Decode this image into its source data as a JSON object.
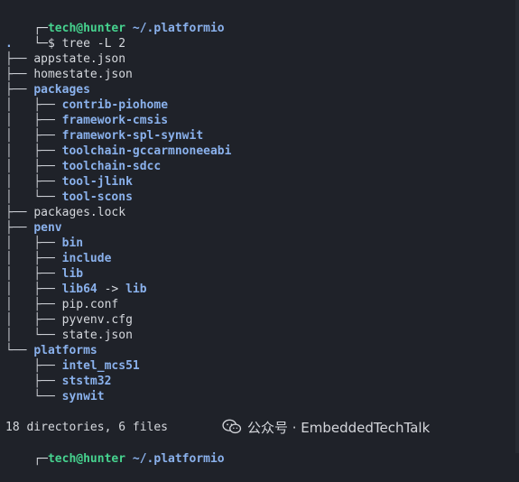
{
  "prompt": {
    "user_host": "tech@hunter",
    "path": "~/.platformio",
    "prefix_top": "┌─",
    "prefix_bottom": "└─",
    "symbol": "$",
    "command": "tree -L 2"
  },
  "tree": {
    "root": ".",
    "entries": [
      {
        "prefix": "├── ",
        "name": "appstate.json",
        "kind": "file"
      },
      {
        "prefix": "├── ",
        "name": "homestate.json",
        "kind": "file"
      },
      {
        "prefix": "├── ",
        "name": "packages",
        "kind": "dir"
      },
      {
        "prefix": "│   ├── ",
        "name": "contrib-piohome",
        "kind": "dir"
      },
      {
        "prefix": "│   ├── ",
        "name": "framework-cmsis",
        "kind": "dir"
      },
      {
        "prefix": "│   ├── ",
        "name": "framework-spl-synwit",
        "kind": "dir"
      },
      {
        "prefix": "│   ├── ",
        "name": "toolchain-gccarmnoneeabi",
        "kind": "dir"
      },
      {
        "prefix": "│   ├── ",
        "name": "toolchain-sdcc",
        "kind": "dir"
      },
      {
        "prefix": "│   ├── ",
        "name": "tool-jlink",
        "kind": "dir"
      },
      {
        "prefix": "│   └── ",
        "name": "tool-scons",
        "kind": "dir"
      },
      {
        "prefix": "├── ",
        "name": "packages.lock",
        "kind": "file"
      },
      {
        "prefix": "├── ",
        "name": "penv",
        "kind": "dir"
      },
      {
        "prefix": "│   ├── ",
        "name": "bin",
        "kind": "dir"
      },
      {
        "prefix": "│   ├── ",
        "name": "include",
        "kind": "dir"
      },
      {
        "prefix": "│   ├── ",
        "name": "lib",
        "kind": "dir"
      },
      {
        "prefix": "│   ├── ",
        "name": "lib64",
        "kind": "link",
        "target": "lib"
      },
      {
        "prefix": "│   ├── ",
        "name": "pip.conf",
        "kind": "file"
      },
      {
        "prefix": "│   ├── ",
        "name": "pyvenv.cfg",
        "kind": "file"
      },
      {
        "prefix": "│   └── ",
        "name": "state.json",
        "kind": "file"
      },
      {
        "prefix": "└── ",
        "name": "platforms",
        "kind": "dir"
      },
      {
        "prefix": "    ├── ",
        "name": "intel_mcs51",
        "kind": "dir"
      },
      {
        "prefix": "    ├── ",
        "name": "ststm32",
        "kind": "dir"
      },
      {
        "prefix": "    └── ",
        "name": "synwit",
        "kind": "dir"
      }
    ],
    "link_arrow": " -> "
  },
  "summary": "18 directories, 6 files",
  "watermark": {
    "text": "公众号 · EmbeddedTechTalk",
    "icon": "wechat-icon"
  },
  "colors": {
    "background": "#1f2229",
    "prompt_user": "#46d38f",
    "directory": "#8ab1ec",
    "text": "#d5d8dd"
  }
}
